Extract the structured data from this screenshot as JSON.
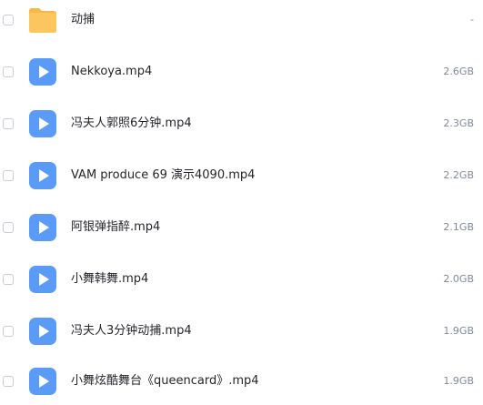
{
  "files": [
    {
      "name": "动捕",
      "size": "-",
      "type": "folder",
      "icon": "folder-icon"
    },
    {
      "name": "Nekkoya.mp4",
      "size": "2.6GB",
      "type": "video",
      "icon": "video-play-icon"
    },
    {
      "name": "冯夫人郭照6分钟.mp4",
      "size": "2.3GB",
      "type": "video",
      "icon": "video-play-icon"
    },
    {
      "name": "VAM produce 69 演示4090.mp4",
      "size": "2.2GB",
      "type": "video",
      "icon": "video-play-icon"
    },
    {
      "name": "阿银弹指醉.mp4",
      "size": "2.1GB",
      "type": "video",
      "icon": "video-play-icon"
    },
    {
      "name": "小舞韩舞.mp4",
      "size": "2.0GB",
      "type": "video",
      "icon": "video-play-icon"
    },
    {
      "name": "冯夫人3分钟动捕.mp4",
      "size": "1.9GB",
      "type": "video",
      "icon": "video-play-icon"
    },
    {
      "name": "小舞炫酷舞台《queencard》.mp4",
      "size": "1.9GB",
      "type": "video",
      "icon": "video-play-icon"
    }
  ],
  "colors": {
    "folder": "#fcc65f",
    "folder_tab": "#f7b84a",
    "video": "#5b9bf8",
    "video_dark": "#4a86ee",
    "text": "#25262b",
    "muted": "#818999"
  }
}
